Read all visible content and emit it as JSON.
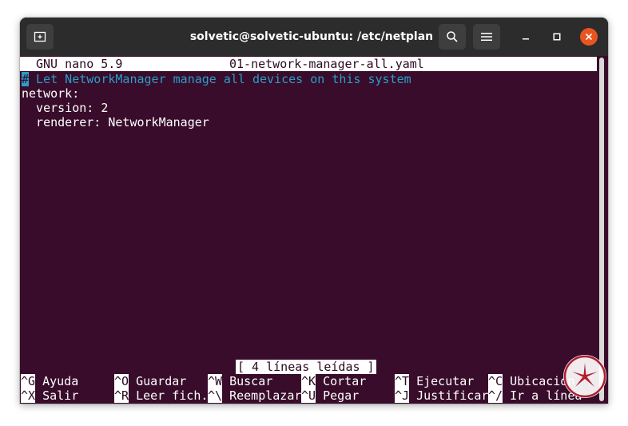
{
  "window": {
    "title": "solvetic@solvetic-ubuntu: /etc/netplan",
    "icons": {
      "new_tab": "new-tab-icon",
      "search": "search-icon",
      "menu": "hamburger-menu-icon",
      "minimize": "minimize-icon",
      "maximize": "maximize-icon",
      "close": "close-icon"
    },
    "colors": {
      "terminal_bg": "#380c2a",
      "titlebar_bg": "#2c2c2c",
      "close_button": "#e95420",
      "comment": "#2a9dc9"
    }
  },
  "nano": {
    "version_label": "GNU nano 5.9",
    "filename": "01-network-manager-all.yaml",
    "lines": [
      {
        "cursor": "#",
        "text": " Let NetworkManager manage all devices on this system"
      },
      {
        "text": "network:"
      },
      {
        "text": "  version: 2"
      },
      {
        "text": "  renderer: NetworkManager"
      }
    ],
    "status": "[ 4 líneas leídas ]",
    "shortcuts_row1": [
      {
        "key": "^G",
        "label": " Ayuda"
      },
      {
        "key": "^O",
        "label": " Guardar"
      },
      {
        "key": "^W",
        "label": " Buscar"
      },
      {
        "key": "^K",
        "label": " Cortar"
      },
      {
        "key": "^T",
        "label": " Ejecutar"
      },
      {
        "key": "^C",
        "label": " Ubicación"
      }
    ],
    "shortcuts_row2": [
      {
        "key": "^X",
        "label": " Salir"
      },
      {
        "key": "^R",
        "label": " Leer fich."
      },
      {
        "key": "^\\",
        "label": " Reemplazar"
      },
      {
        "key": "^U",
        "label": " Pegar"
      },
      {
        "key": "^J",
        "label": " Justificar"
      },
      {
        "key": "^/",
        "label": " Ir a línea"
      }
    ]
  },
  "watermark": {
    "icon": "solvetic-logo-icon"
  }
}
